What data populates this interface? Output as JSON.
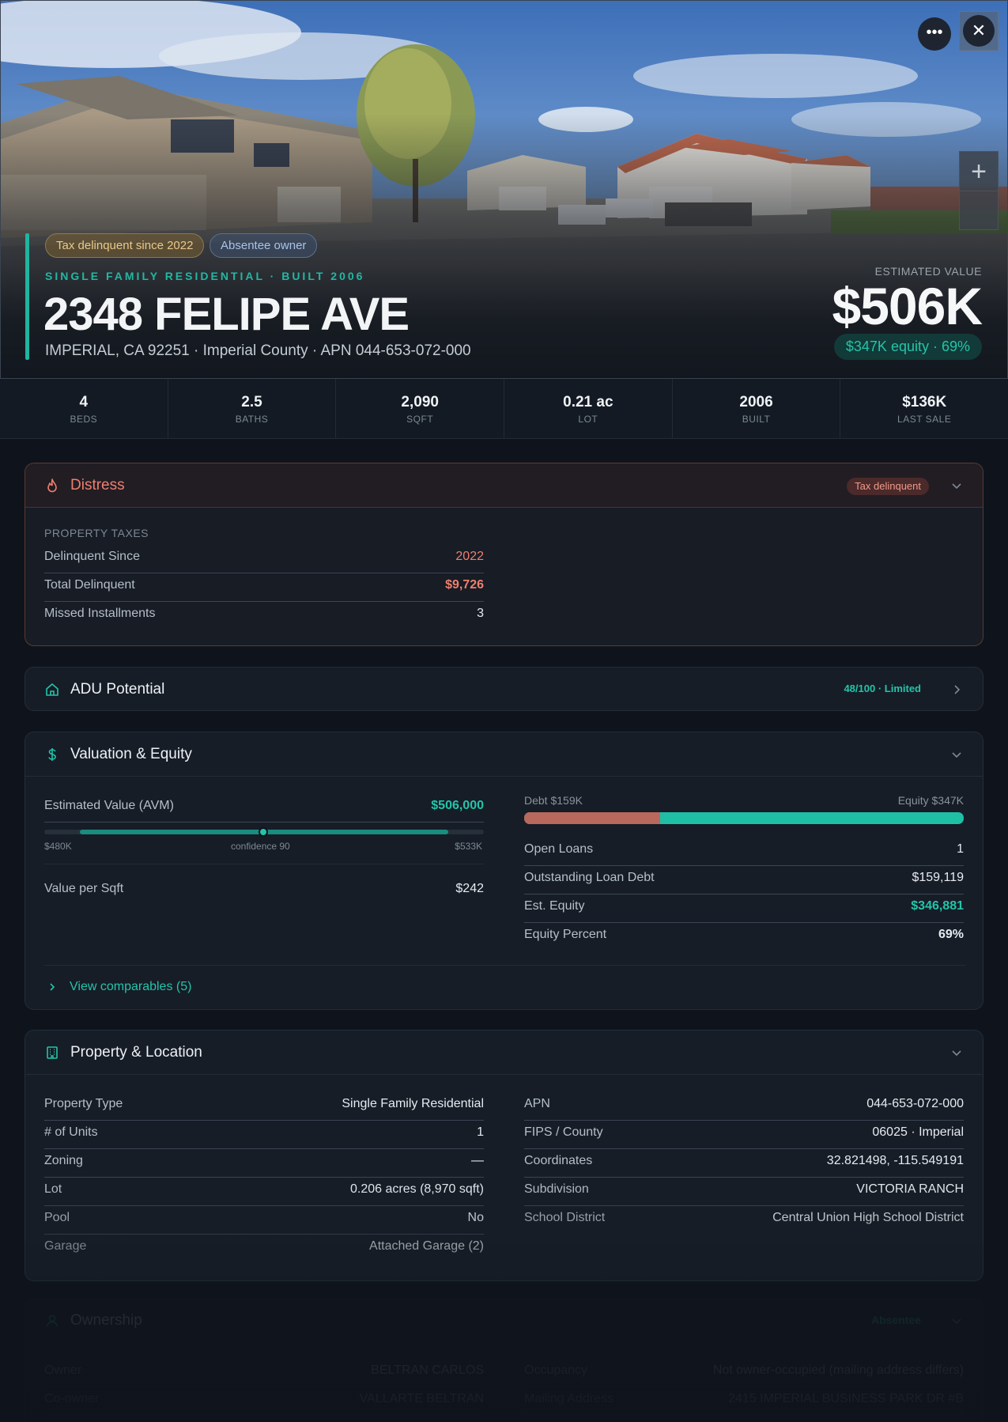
{
  "hero": {
    "badges": [
      "Tax delinquent since 2022",
      "Absentee owner"
    ],
    "subtitle": "SINGLE FAMILY RESIDENTIAL · BUILT 2006",
    "address": "2348 FELIPE AVE",
    "location": "IMPERIAL, CA 92251 · Imperial County · APN 044-653-072-000",
    "estimated_label": "ESTIMATED VALUE",
    "estimated_value": "$506K",
    "equity_badge": "$347K equity · 69%",
    "more_icon": "ellipsis-icon",
    "close_icon": "close-icon",
    "zoom_in_label": "+"
  },
  "stats": [
    {
      "value": "4",
      "label": "BEDS"
    },
    {
      "value": "2.5",
      "label": "BATHS"
    },
    {
      "value": "2,090",
      "label": "SQFT"
    },
    {
      "value": "0.21 ac",
      "label": "LOT"
    },
    {
      "value": "2006",
      "label": "BUILT"
    },
    {
      "value": "$136K",
      "label": "LAST SALE"
    }
  ],
  "distress": {
    "title": "Distress",
    "tag": "Tax delinquent",
    "section": "PROPERTY TAXES",
    "rows": [
      {
        "label": "Delinquent Since",
        "value": "2022"
      },
      {
        "label": "Total Delinquent",
        "value": "$9,726"
      },
      {
        "label": "Missed Installments",
        "value": "3"
      }
    ],
    "accent": "#ef7f6e"
  },
  "adu": {
    "title": "ADU Potential",
    "score": "48/100 · Limited"
  },
  "valuation": {
    "title": "Valuation & Equity",
    "avm_label": "Estimated Value (AVM)",
    "avm_value": "$506,000",
    "range_low": "$480K",
    "range_high": "$533K",
    "confidence_text": "confidence 90",
    "value_per_sqft_label": "Value per Sqft",
    "value_per_sqft": "$242",
    "debt_label": "Debt $159K",
    "equity_label": "Equity $347K",
    "debt_fraction": 0.31,
    "rows": [
      {
        "label": "Open Loans",
        "value": "1"
      },
      {
        "label": "Outstanding Loan Debt",
        "value": "$159,119"
      },
      {
        "label": "Est. Equity",
        "value": "$346,881"
      },
      {
        "label": "Equity Percent",
        "value": "69%"
      }
    ],
    "comparables_link": "View comparables (5)"
  },
  "property": {
    "title": "Property & Location",
    "left_rows": [
      {
        "label": "Property Type",
        "value": "Single Family Residential"
      },
      {
        "label": "# of Units",
        "value": "1"
      },
      {
        "label": "Zoning",
        "value": "—"
      },
      {
        "label": "Lot",
        "value": "0.206 acres (8,970 sqft)"
      },
      {
        "label": "Pool",
        "value": "No"
      },
      {
        "label": "Garage",
        "value": "Attached Garage (2)"
      }
    ],
    "right_rows": [
      {
        "label": "APN",
        "value": "044-653-072-000"
      },
      {
        "label": "FIPS / County",
        "value": "06025 · Imperial"
      },
      {
        "label": "Coordinates",
        "value": "32.821498, -115.549191"
      },
      {
        "label": "Subdivision",
        "value": "VICTORIA RANCH"
      },
      {
        "label": "School District",
        "value": "Central Union High School District"
      }
    ]
  },
  "ownership": {
    "title": "Ownership",
    "badge": "Absentee",
    "left_rows": [
      {
        "label": "Owner",
        "value": "BELTRAN CARLOS"
      },
      {
        "label": "Co-owner",
        "value": "VALLARTE BELTRAN"
      }
    ],
    "right_rows": [
      {
        "label": "Occupancy",
        "value": "Not owner-occupied (mailing address differs)"
      },
      {
        "label": "Mailing Address",
        "value": "2415 IMPERIAL BUSINESS PARK DR #B"
      }
    ]
  },
  "colors": {
    "accent_teal": "#24c4a9",
    "distress_red": "#ef7f6e",
    "background": "#0f141c"
  }
}
